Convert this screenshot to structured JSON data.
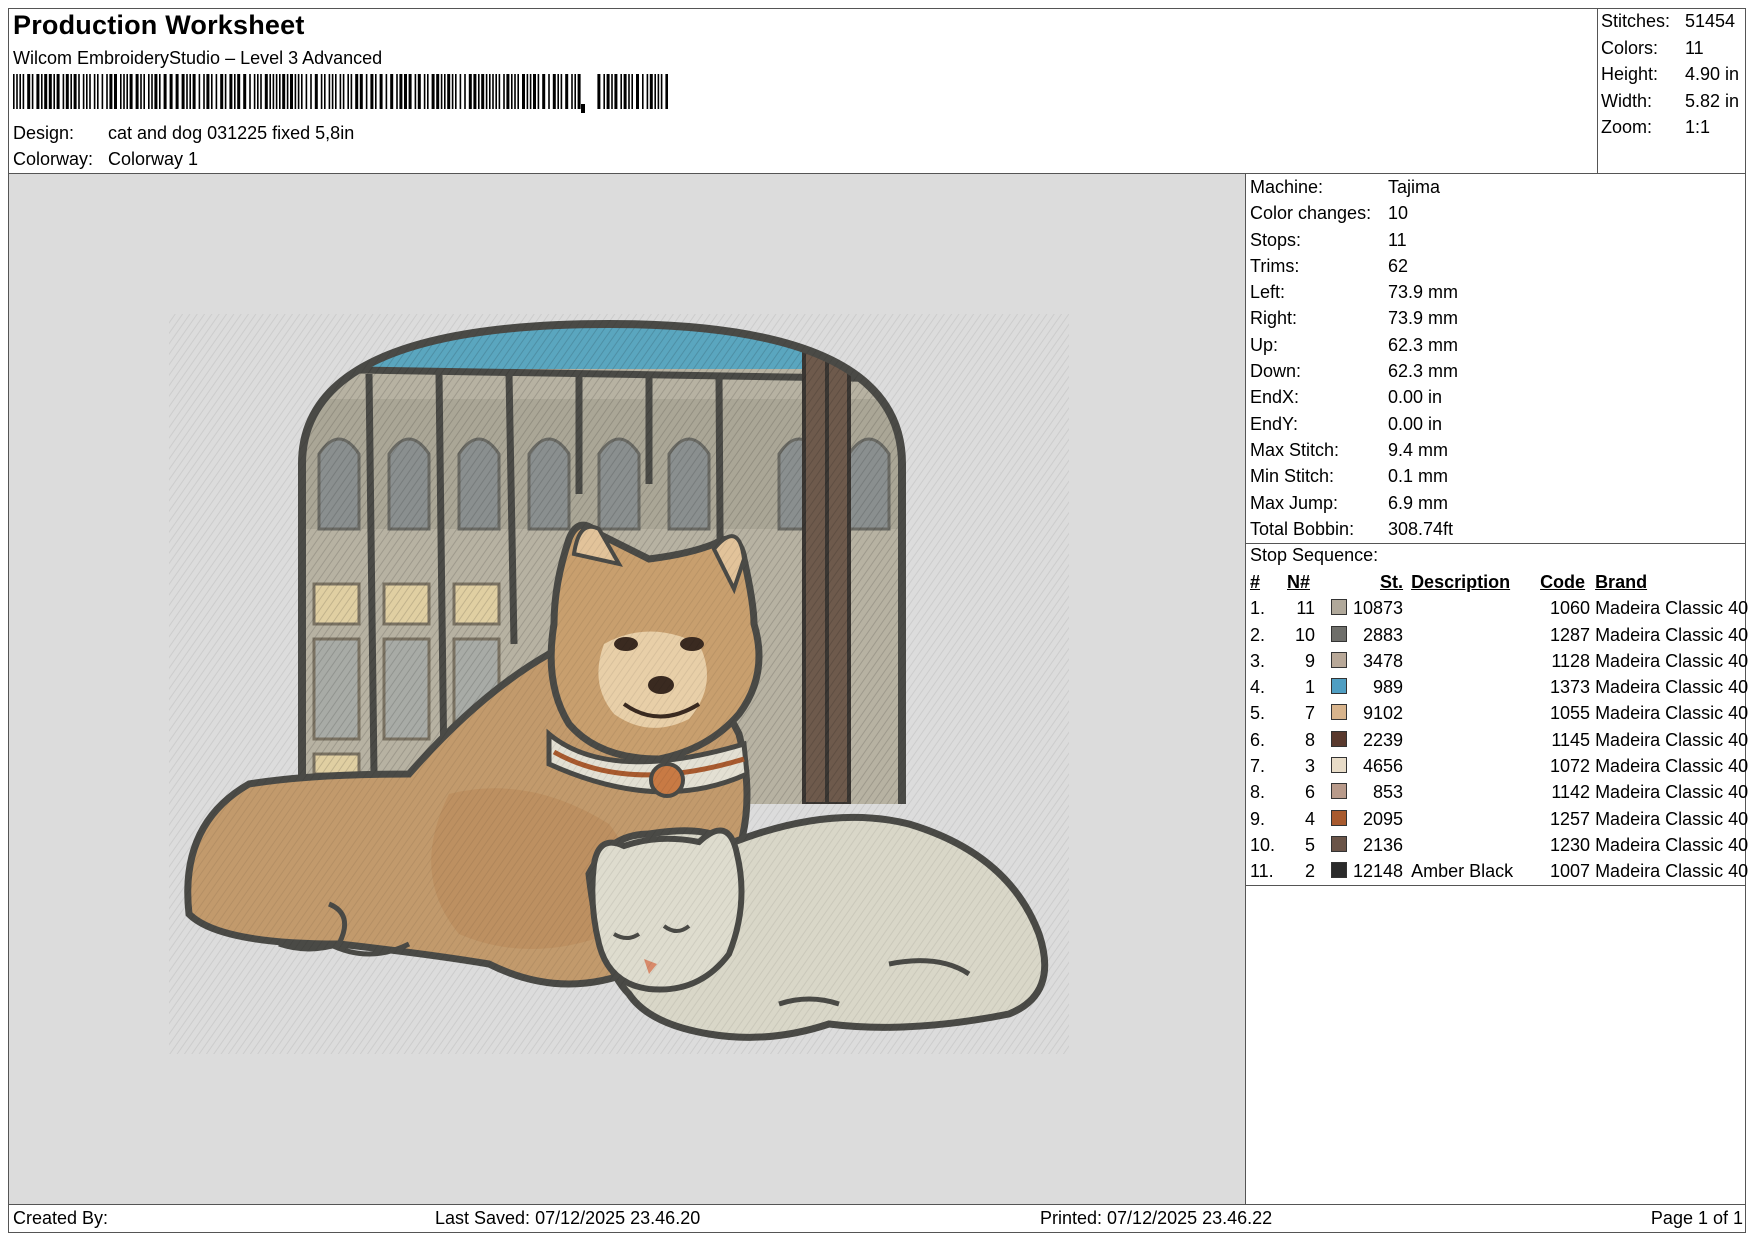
{
  "header": {
    "title": "Production Worksheet",
    "software": "Wilcom EmbroideryStudio – Level 3 Advanced",
    "design_label": "Design:",
    "design_value": "cat and dog 031225 fixed 5,8in",
    "colorway_label": "Colorway:",
    "colorway_value": "Colorway 1"
  },
  "summary": [
    {
      "label": "Stitches:",
      "value": "51454"
    },
    {
      "label": "Colors:",
      "value": "11"
    },
    {
      "label": "Height:",
      "value": "4.90 in"
    },
    {
      "label": "Width:",
      "value": "5.82 in"
    },
    {
      "label": "Zoom:",
      "value": "1:1"
    }
  ],
  "machine_info": [
    {
      "label": "Machine:",
      "value": "Tajima"
    },
    {
      "label": "Color changes:",
      "value": "10"
    },
    {
      "label": "Stops:",
      "value": "11"
    },
    {
      "label": "Trims:",
      "value": "62"
    },
    {
      "label": "Left:",
      "value": "73.9 mm"
    },
    {
      "label": "Right:",
      "value": "73.9 mm"
    },
    {
      "label": "Up:",
      "value": "62.3 mm"
    },
    {
      "label": "Down:",
      "value": "62.3 mm"
    },
    {
      "label": "EndX:",
      "value": "0.00 in"
    },
    {
      "label": "EndY:",
      "value": "0.00 in"
    },
    {
      "label": "Max Stitch:",
      "value": "9.4 mm"
    },
    {
      "label": "Min Stitch:",
      "value": "0.1 mm"
    },
    {
      "label": "Max Jump:",
      "value": "6.9 mm"
    },
    {
      "label": "Total Bobbin:",
      "value": "308.74ft"
    }
  ],
  "stop_sequence": {
    "title": "Stop Sequence:",
    "headers": {
      "idx": "#",
      "n": "N#",
      "st": "St.",
      "desc": "Description",
      "code": "Code",
      "brand": "Brand"
    },
    "rows": [
      {
        "idx": "1.",
        "n": "11",
        "color": "#b0a89a",
        "st": "10873",
        "desc": "",
        "code": "1060",
        "brand": "Madeira Classic 40"
      },
      {
        "idx": "2.",
        "n": "10",
        "color": "#6e6e6a",
        "st": "2883",
        "desc": "",
        "code": "1287",
        "brand": "Madeira Classic 40"
      },
      {
        "idx": "3.",
        "n": "9",
        "color": "#b8a898",
        "st": "3478",
        "desc": "",
        "code": "1128",
        "brand": "Madeira Classic 40"
      },
      {
        "idx": "4.",
        "n": "1",
        "color": "#4f9ec2",
        "st": "989",
        "desc": "",
        "code": "1373",
        "brand": "Madeira Classic 40"
      },
      {
        "idx": "5.",
        "n": "7",
        "color": "#d8b48c",
        "st": "9102",
        "desc": "",
        "code": "1055",
        "brand": "Madeira Classic 40"
      },
      {
        "idx": "6.",
        "n": "8",
        "color": "#5a3a2e",
        "st": "2239",
        "desc": "",
        "code": "1145",
        "brand": "Madeira Classic 40"
      },
      {
        "idx": "7.",
        "n": "3",
        "color": "#e8dcc8",
        "st": "4656",
        "desc": "",
        "code": "1072",
        "brand": "Madeira Classic 40"
      },
      {
        "idx": "8.",
        "n": "6",
        "color": "#b89a8a",
        "st": "853",
        "desc": "",
        "code": "1142",
        "brand": "Madeira Classic 40"
      },
      {
        "idx": "9.",
        "n": "4",
        "color": "#a85a2e",
        "st": "2095",
        "desc": "",
        "code": "1257",
        "brand": "Madeira Classic 40"
      },
      {
        "idx": "10.",
        "n": "5",
        "color": "#6a5448",
        "st": "2136",
        "desc": "",
        "code": "1230",
        "brand": "Madeira Classic 40"
      },
      {
        "idx": "11.",
        "n": "2",
        "color": "#2a2a2a",
        "st": "12148",
        "desc": "Amber Black",
        "code": "1007",
        "brand": "Madeira Classic 40"
      }
    ]
  },
  "footer": {
    "created_by": "Created By:",
    "last_saved": "Last Saved: 07/12/2025 23.46.20",
    "printed": "Printed: 07/12/2025 23.46.22",
    "page": "Page 1 of 1"
  },
  "colors": {
    "preview_background": "#dcdcdc",
    "outline": "#4a4a46",
    "sky": "#5aa6bf",
    "building": "#b7b2a2",
    "dog_fur": "#c29a6c",
    "cat_fur": "#d9d7c8"
  }
}
